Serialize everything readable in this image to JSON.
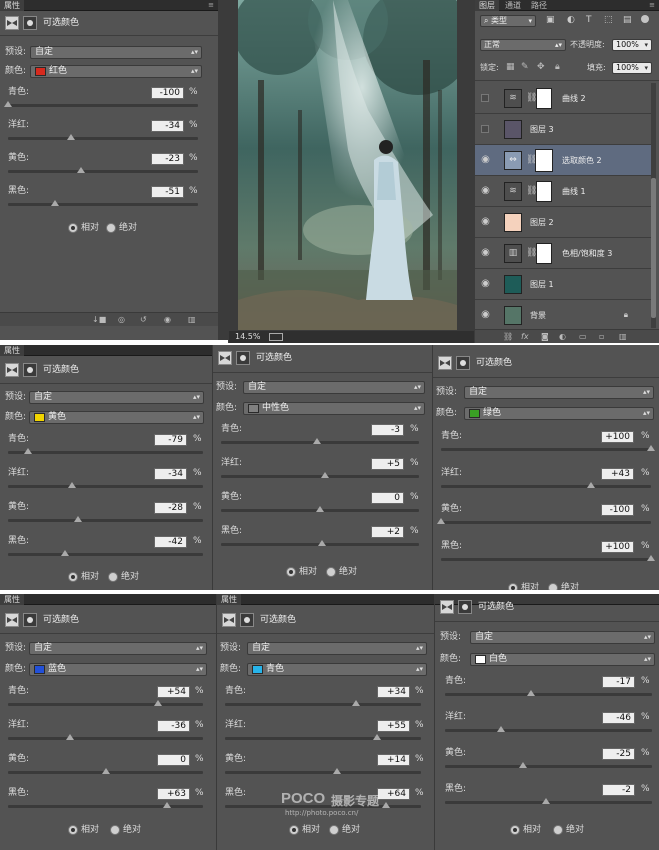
{
  "common": {
    "tab_properties": "属性",
    "panel_title": "可选颜色",
    "preset_label": "预设:",
    "preset_value": "自定",
    "colors_label": "颜色:",
    "cyan_label": "青色:",
    "magenta_label": "洋红:",
    "yellow_label": "黄色:",
    "black_label": "黑色:",
    "percent": "%",
    "relative": "相对",
    "absolute": "绝对"
  },
  "panel_red": {
    "color_name": "红色",
    "swatch": "#d62a1e",
    "cyan": "-100",
    "magenta": "-34",
    "yellow": "-23",
    "black": "-51"
  },
  "panel_yellow": {
    "color_name": "黄色",
    "swatch": "#f1d400",
    "cyan": "-79",
    "magenta": "-34",
    "yellow": "-28",
    "black": "-42"
  },
  "panel_neutral": {
    "color_name": "中性色",
    "swatch": "#808080",
    "cyan": "-3",
    "magenta": "+5",
    "yellow": "0",
    "black": "+2"
  },
  "panel_green": {
    "color_name": "绿色",
    "swatch": "#3aa024",
    "cyan": "+100",
    "magenta": "+43",
    "yellow": "-100",
    "black": "+100"
  },
  "panel_blue": {
    "color_name": "蓝色",
    "swatch": "#2250d8",
    "cyan": "+54",
    "magenta": "-36",
    "yellow": "0",
    "black": "+63"
  },
  "panel_cyan": {
    "color_name": "青色",
    "swatch": "#27b4ea",
    "cyan": "+34",
    "magenta": "+55",
    "yellow": "+14",
    "black": "+64"
  },
  "panel_white": {
    "color_name": "白色",
    "swatch": "#ffffff",
    "cyan": "-17",
    "magenta": "-46",
    "yellow": "-25",
    "black": "-2"
  },
  "layers_panel": {
    "tabs": [
      "图层",
      "通道",
      "路径"
    ],
    "kind_filter": "类型",
    "blend_mode": "正常",
    "opacity_label": "不透明度:",
    "opacity_value": "100%",
    "lock_label": "锁定:",
    "fill_label": "填充:",
    "fill_value": "100%",
    "layers": [
      {
        "name": "曲线 2",
        "visible": false
      },
      {
        "name": "图层 3",
        "visible": false,
        "color": "#5a5568"
      },
      {
        "name": "选取颜色 2",
        "visible": true,
        "selected": true
      },
      {
        "name": "曲线 1",
        "visible": true
      },
      {
        "name": "图层 2",
        "visible": true,
        "color": "#f5d2bd"
      },
      {
        "name": "色相/饱和度 3",
        "visible": true
      },
      {
        "name": "图层 1",
        "visible": true,
        "color": "#1e5c58"
      },
      {
        "name": "背景",
        "visible": true,
        "locked": true
      }
    ]
  },
  "canvas": {
    "zoom": "14.5%"
  },
  "watermark": {
    "brand": "POCO",
    "sub": "摄影专题",
    "url": "http://photo.poco.cn/"
  }
}
